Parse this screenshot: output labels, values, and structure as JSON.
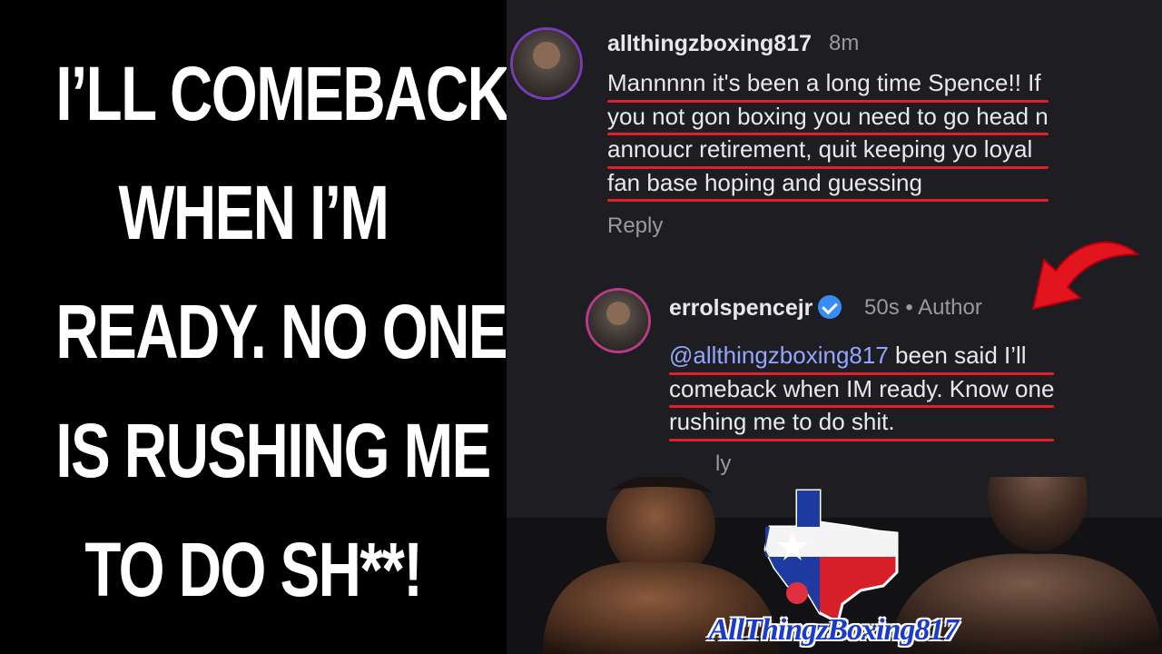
{
  "headline": {
    "lines": [
      "I’LL COMEBACK",
      "WHEN I’M",
      "READY. NO ONE",
      "IS RUSHING ME",
      "TO DO SH**!"
    ]
  },
  "comment": {
    "username": "allthingzboxing817",
    "time": "8m",
    "lines": [
      "Mannnnn it's been a long time Spence!! If",
      "you not gon boxing you need to go head n",
      "annoucr retirement, quit keeping yo loyal",
      "fan base hoping and guessing"
    ],
    "reply_label": "Reply"
  },
  "reply": {
    "username": "errolspencejr",
    "time": "50s",
    "author_label": "• Author",
    "mention": "@allthingzboxing817",
    "line1_rest": " been said I’ll",
    "line2": "comeback when IM ready. Know one",
    "line3": "rushing me to do shit.",
    "reply_label": "ly"
  },
  "logo": {
    "text": "AllThingzBoxing817"
  },
  "colors": {
    "accent_underline": "#e0202a",
    "mention": "#93a6ff",
    "verified": "#3a8cf5",
    "panel_bg": "#1e1e22"
  }
}
